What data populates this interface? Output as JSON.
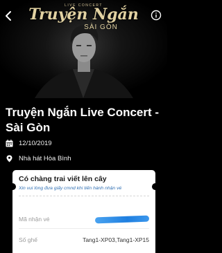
{
  "banner": {
    "brand_top": "LIVE CONCERT",
    "brand_title": "Truyện Ngắn",
    "brand_subtitle": "SÀI GÒN"
  },
  "event": {
    "title": "Truyện Ngắn Live Concert - Sài Gòn",
    "date": "12/10/2019",
    "venue": "Nhà hát Hòa Bình"
  },
  "ticket": {
    "title": "Có chàng trai viết lên cây",
    "note": "Xin vui lòng đưa giấy cmnd khi tiến hành nhận vé",
    "ticket_code_label": "Mã nhận vé",
    "seat_label": "Số ghế",
    "seat_value": "Tang1-XP03,Tang1-XP15"
  },
  "icons": {
    "back": "chevron-left-icon",
    "info": "info-icon",
    "date": "calendar-icon",
    "venue": "location-pin-icon"
  },
  "colors": {
    "background": "#000000",
    "card": "#ffffff",
    "note": "#2f6fb3",
    "brand_gold": "#e2d2a2",
    "redaction": "#1f7fe0"
  }
}
